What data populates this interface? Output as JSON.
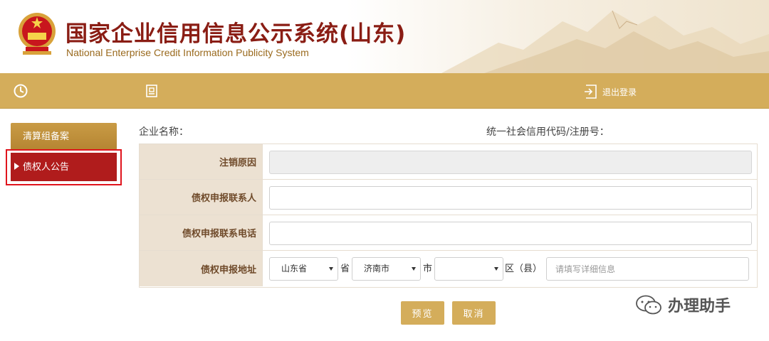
{
  "header": {
    "title_cn": "国家企业信用信息公示系统(山东)",
    "title_en": "National Enterprise Credit Information Publicity System"
  },
  "navbar": {
    "logout_label": "退出登录",
    "icons": [
      "clock-icon",
      "document-stamp-icon",
      "logout-icon"
    ]
  },
  "sidebar": {
    "items": [
      {
        "label": "清算组备案",
        "active": false
      },
      {
        "label": "债权人公告",
        "active": true
      }
    ]
  },
  "info": {
    "company_name_label": "企业名称：",
    "credit_code_label": "统一社会信用代码/注册号："
  },
  "form": {
    "rows": [
      {
        "label": "注销原因",
        "value": ""
      },
      {
        "label": "债权申报联系人",
        "value": ""
      },
      {
        "label": "债权申报联系电话",
        "value": ""
      },
      {
        "label": "债权申报地址"
      }
    ],
    "address": {
      "province": "山东省",
      "province_unit": "省",
      "city": "济南市",
      "city_unit": "市",
      "district": "",
      "district_unit": "区（县）",
      "detail_placeholder": "请填写详细信息"
    }
  },
  "buttons": {
    "preview": "预览",
    "cancel": "取消"
  },
  "watermark": {
    "text": "办理助手"
  },
  "colors": {
    "gold": "#d4ad5b",
    "active_red": "#b01c1c",
    "highlight_red": "#e0141d",
    "title_red": "#8a1d14"
  }
}
